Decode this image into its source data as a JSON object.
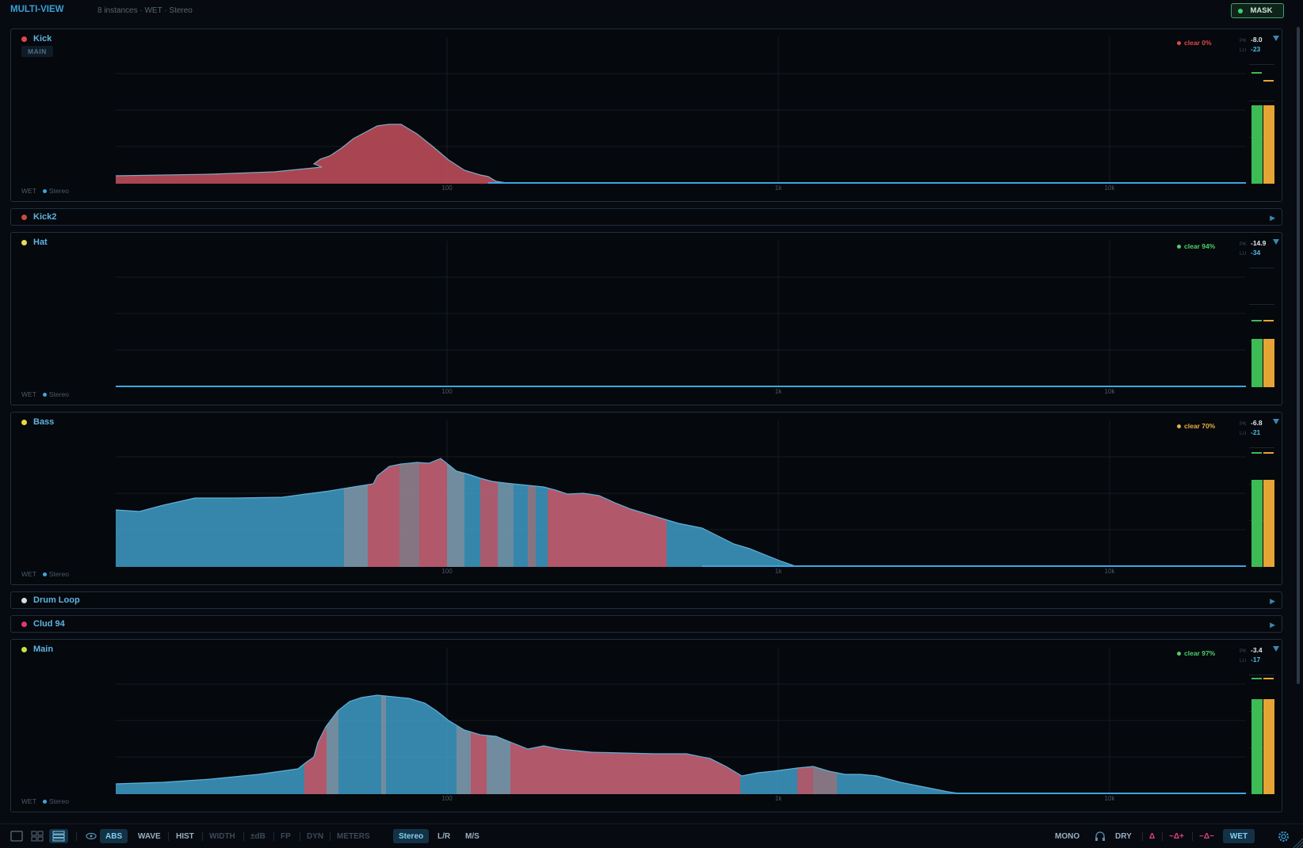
{
  "header": {
    "title": "MULTI-VIEW",
    "subtitle": "8 instances · WET · Stereo",
    "mask_label": "MASK"
  },
  "xticks": [
    "100",
    "1k",
    "10k"
  ],
  "tracks": [
    {
      "name": "Kick",
      "color": "#e04848",
      "expanded": true,
      "badge": "MAIN",
      "clear_label": "clear 0%",
      "clear_color": "#e04848",
      "pk_label": "PK",
      "pk": "-8.0",
      "lu_label": "LU",
      "lu": "-23",
      "foot_mode": "WET",
      "foot_channel": "Stereo",
      "meter_level": 0.72,
      "peak_hold": [
        0.93,
        0.86
      ]
    },
    {
      "name": "Kick2",
      "color": "#c84a40",
      "expanded": false
    },
    {
      "name": "Hat",
      "color": "#e8d860",
      "expanded": true,
      "clear_label": "clear 94%",
      "clear_color": "#4bd06e",
      "pk_label": "PK",
      "pk": "-14.9",
      "lu_label": "LU",
      "lu": "-34",
      "foot_mode": "WET",
      "foot_channel": "Stereo",
      "meter_level": 0.44,
      "peak_hold": [
        0.86,
        0.86
      ]
    },
    {
      "name": "Bass",
      "color": "#e8d840",
      "expanded": true,
      "clear_label": "clear 70%",
      "clear_color": "#e8b040",
      "pk_label": "PK",
      "pk": "-6.8",
      "lu_label": "LU",
      "lu": "-21",
      "foot_mode": "WET",
      "foot_channel": "Stereo",
      "meter_level": 0.8,
      "peak_hold": [
        1.08,
        1.08
      ]
    },
    {
      "name": "Drum Loop",
      "color": "#d8dde2",
      "expanded": false
    },
    {
      "name": "Clud 94",
      "color": "#e0367a",
      "expanded": false
    },
    {
      "name": "Main",
      "color": "#c8e040",
      "expanded": true,
      "clear_label": "clear 97%",
      "clear_color": "#4bd06e",
      "pk_label": "PK",
      "pk": "-3.4",
      "lu_label": "LU",
      "lu": "-17",
      "foot_mode": "WET",
      "foot_channel": "Stereo",
      "meter_level": 0.88,
      "peak_hold": [
        1.12,
        1.12
      ]
    }
  ],
  "toolbar": {
    "view_icons": [
      "single-view-icon",
      "grid-view-icon",
      "stack-view-icon"
    ],
    "modes": [
      "ABS",
      "WAVE",
      "HIST",
      "WIDTH",
      "±dB",
      "FP",
      "DYN",
      "METERS"
    ],
    "active_mode": "ABS",
    "channels": [
      "Stereo",
      "L/R",
      "M/S"
    ],
    "active_channel": "Stereo",
    "right": {
      "mono": "MONO",
      "dry": "DRY",
      "delta": "Δ",
      "delta_plus": "~Δ+",
      "delta_minus": "~Δ−",
      "wet": "WET"
    }
  },
  "colors": {
    "accent": "#3aa0d8",
    "spectrum_blue": "#3f9cc8",
    "spectrum_red": "#c7505e",
    "meter_green": "#3dbb55",
    "meter_orange": "#e6a435"
  }
}
